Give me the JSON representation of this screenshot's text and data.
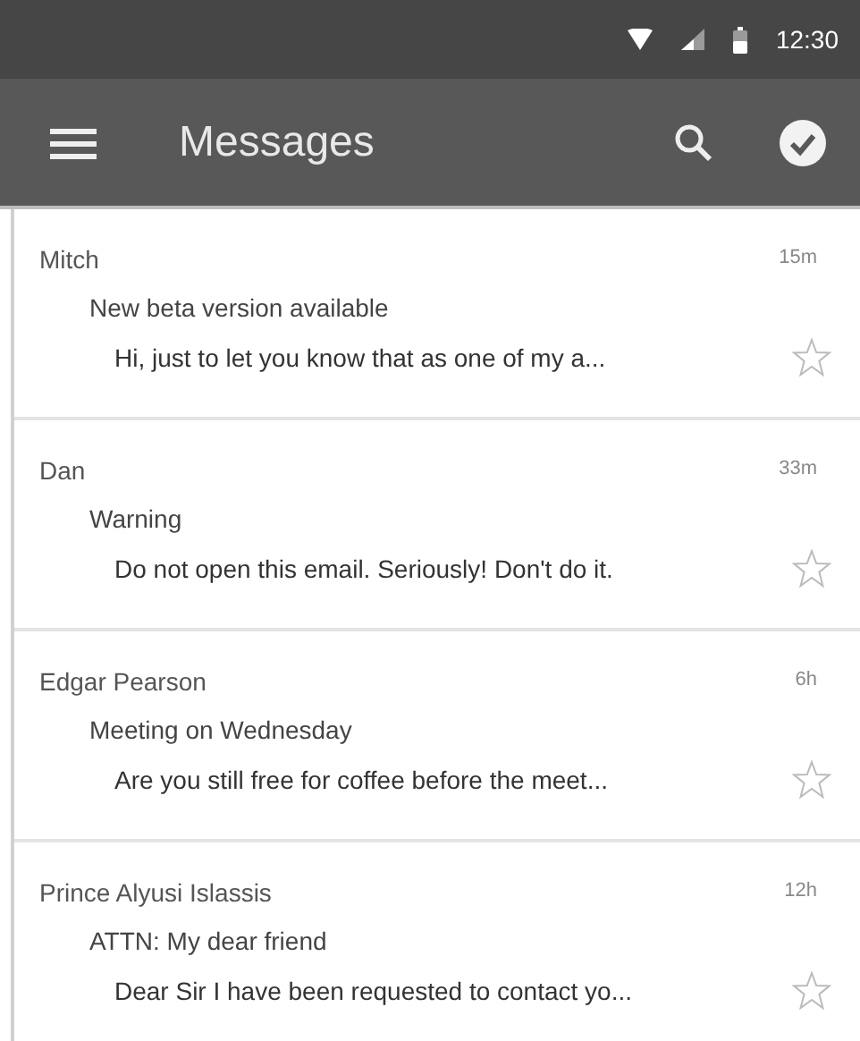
{
  "status_bar": {
    "time": "12:30"
  },
  "app_bar": {
    "title": "Messages"
  },
  "messages": [
    {
      "sender": "Mitch",
      "time": "15m",
      "subject": "New beta version available",
      "preview": "Hi, just to let you know that as one of my a...",
      "starred": false
    },
    {
      "sender": "Dan",
      "time": "33m",
      "subject": "Warning",
      "preview": "Do not open this email. Seriously! Don't do it.",
      "starred": false
    },
    {
      "sender": "Edgar Pearson",
      "time": "6h",
      "subject": "Meeting on Wednesday",
      "preview": "Are you still free for coffee before the meet...",
      "starred": false
    },
    {
      "sender": "Prince Alyusi Islassis",
      "time": "12h",
      "subject": "ATTN: My dear friend",
      "preview": "Dear Sir I have been requested to contact yo...",
      "starred": false
    }
  ]
}
